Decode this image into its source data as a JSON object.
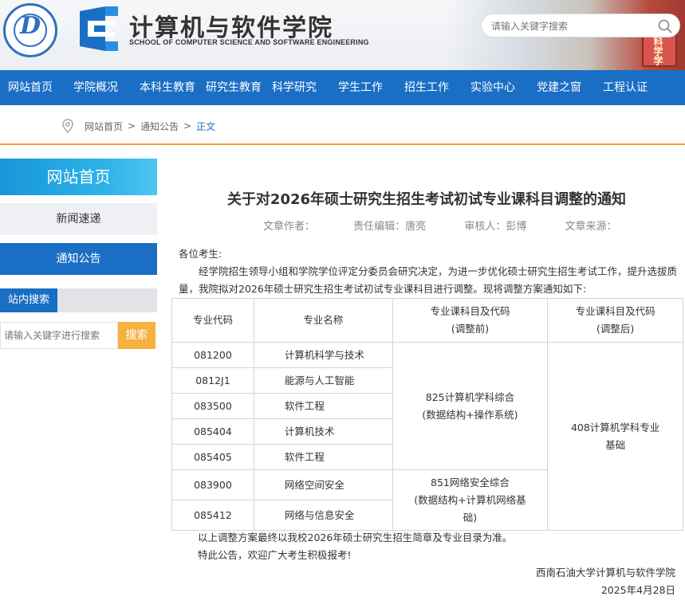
{
  "header": {
    "logo_letter": "D",
    "school_name_cn": "计算机与软件学院",
    "school_name_en": "SCHOOL OF COMPUTER SCIENCE AND SOFTWARE ENGINEERING",
    "search_placeholder": "请输入关键字搜索",
    "building_sign": "科学学"
  },
  "nav": {
    "items": [
      "网站首页",
      "学院概况",
      "本科生教育",
      "研究生教育",
      "科学研究",
      "学生工作",
      "招生工作",
      "实验中心",
      "党建之窗",
      "工程认证"
    ]
  },
  "breadcrumb": {
    "home": "网站首页",
    "section": "通知公告",
    "current": "正文",
    "separator": ">"
  },
  "sidebar": {
    "title": "网站首页",
    "items": [
      "新闻速递",
      "通知公告"
    ],
    "search_label": "站内搜索",
    "search_placeholder": "请输入关键字进行搜索",
    "search_button": "搜索"
  },
  "article": {
    "title": "关于对2026年硕士研究生招生考试初试专业课科目调整的通知",
    "meta": {
      "author": "文章作者：",
      "editor": "责任编辑：唐亮",
      "reviewer": "审核人：彭博",
      "source": "文章来源："
    },
    "greeting": "各位考生:",
    "body": "经学院招生领导小组和学院学位评定分委员会研究决定，为进一步优化硕士研究生招生考试工作，提升选拔质量，我院拟对2026年硕士研究生招生考试初试专业课科目进行调整。现将调整方案通知如下:",
    "table": {
      "headers": {
        "code": "专业代码",
        "name": "专业名称",
        "before_line1": "专业课科目及代码",
        "before_line2": "(调整前)",
        "after_line1": "专业课科目及代码",
        "after_line2": "(调整后)"
      },
      "rows": [
        {
          "code": "081200",
          "name": "计算机科学与技术"
        },
        {
          "code": "0812J1",
          "name": "能源与人工智能"
        },
        {
          "code": "083500",
          "name": "软件工程"
        },
        {
          "code": "085404",
          "name": "计算机技术"
        },
        {
          "code": "085405",
          "name": "软件工程"
        },
        {
          "code": "083900",
          "name": "网络空间安全"
        },
        {
          "code": "085412",
          "name": "网络与信息安全"
        }
      ],
      "before_group1_line1": "825计算机学科综合",
      "before_group1_line2": "(数据结构+操作系统)",
      "before_group2_line1": "851网络安全综合",
      "before_group2_line2": "(数据结构+计算机网络基",
      "before_group2_line3": "础)",
      "after_line1": "408计算机学科专业",
      "after_line2": "基础"
    },
    "footer1": "以上调整方案最终以我校2026年硕士研究生招生简章及专业目录为准。",
    "footer2": "特此公告，欢迎广大考生积极报考!",
    "signature": "西南石油大学计算机与软件学院",
    "date": "2025年4月28日"
  }
}
